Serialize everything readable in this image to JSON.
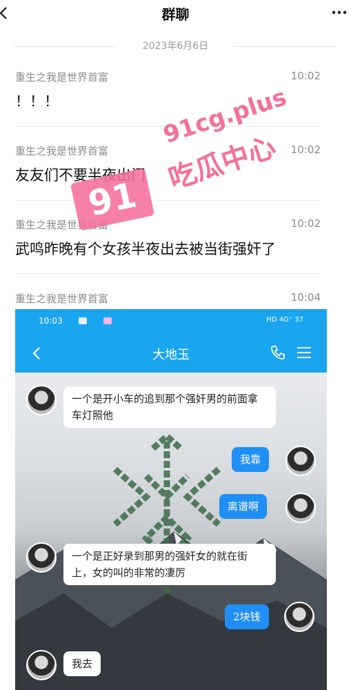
{
  "header": {
    "title": "群聊"
  },
  "date_separator": "2023年6月6日",
  "messages": [
    {
      "sender": "重生之我是世界首富",
      "time": "10:02",
      "text": "！！！"
    },
    {
      "sender": "重生之我是世界首富",
      "time": "10:02",
      "text": "友友们不要半夜出门"
    },
    {
      "sender": "重生之我是世界首富",
      "time": "10:02",
      "text": "武鸣昨晚有个女孩半夜出去被当街强奸了"
    },
    {
      "sender": "重生之我是世界首富",
      "time": "10:04",
      "text": ""
    }
  ],
  "screenshot": {
    "status_time": "10:03",
    "status_right": "HD 4G⁺ 37",
    "chat_title": "大地玉",
    "bubbles": [
      {
        "side": "left",
        "text": "一个是开小车的追到那个强奸男的前面拿车灯照他"
      },
      {
        "side": "right",
        "text": "我靠"
      },
      {
        "side": "right",
        "text": "离谱啊"
      },
      {
        "side": "left",
        "text": "一个是正好录到那男的强奸女的就在街上，女的叫的非常的凄厉"
      },
      {
        "side": "right",
        "text": "2块钱"
      },
      {
        "side": "left",
        "text": "我去"
      }
    ]
  },
  "watermark": {
    "url": "91cg.plus",
    "badge": "91",
    "label": "吃瓜中心"
  },
  "colors": {
    "accent_blue": "#1aa5ef",
    "bubble_blue": "#1f8ff5",
    "watermark_pink": "#f45d8c"
  }
}
